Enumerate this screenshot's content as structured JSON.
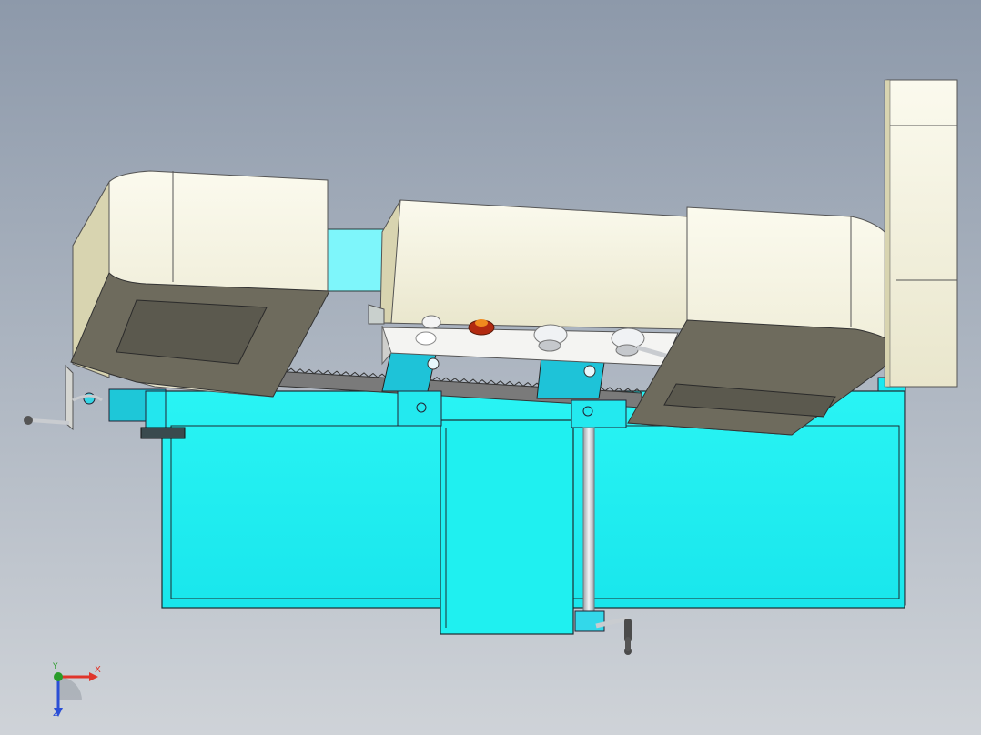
{
  "viewport": {
    "background_top": "#8d99aa",
    "background_bottom": "#cfd3d8"
  },
  "model": {
    "description_icon": "band-saw-machine-3d-model",
    "colors": {
      "base": "#1ff0f0",
      "base_dark": "#13b8c8",
      "housing": "#f6f4e0",
      "housing_side": "#d9d6b6",
      "housing_bottom": "#6f6d60",
      "blade": "#6a6a6a",
      "knob_red": "#b22a10",
      "handle_metal": "#c9ccd0"
    }
  },
  "triad": {
    "x_label": "X",
    "y_label": "Y",
    "z_label": "Z",
    "x_color": "#e0352b",
    "y_color": "#2a9c2a",
    "z_color": "#2b4fd6"
  }
}
